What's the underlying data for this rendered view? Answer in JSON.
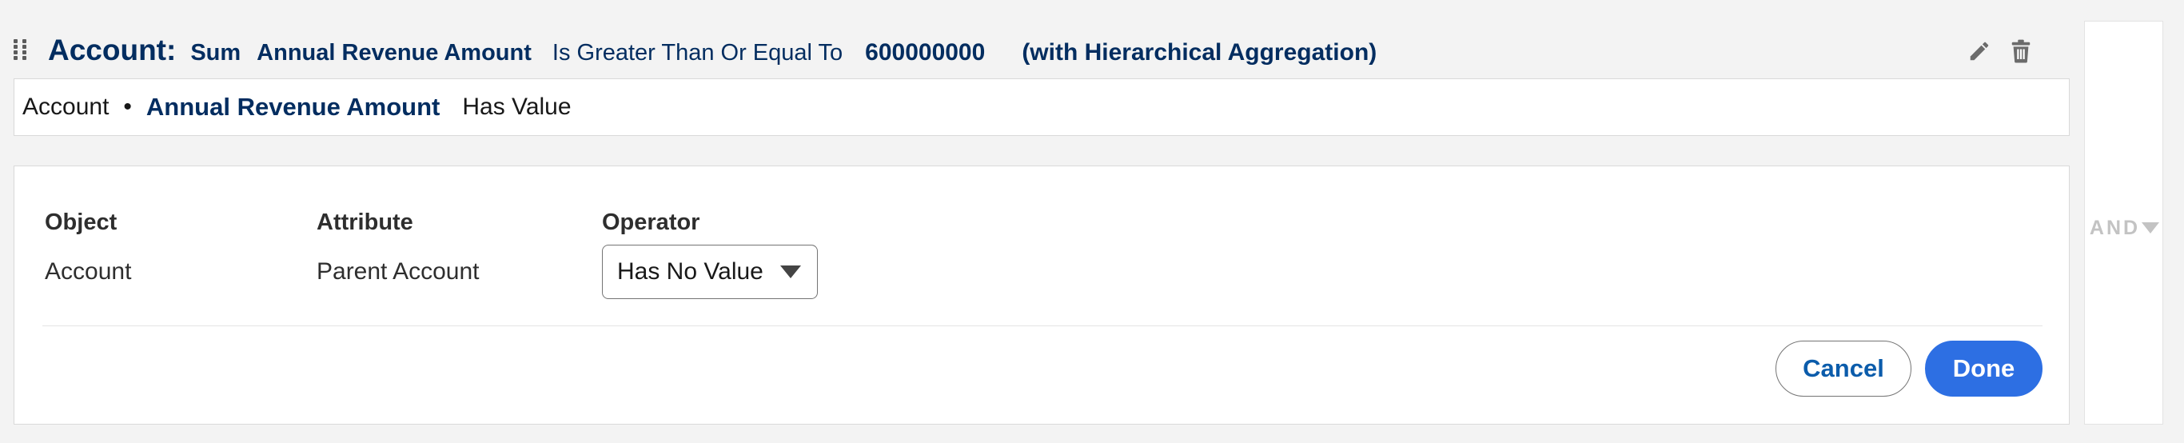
{
  "header": {
    "object_label": "Account:",
    "aggregation": "Sum",
    "field": "Annual Revenue Amount",
    "operator": "Is Greater Than Or Equal To",
    "value": "600000000",
    "note": "(with Hierarchical Aggregation)",
    "icons": [
      "drag-handle-icon",
      "pencil-icon",
      "trash-icon"
    ]
  },
  "summary": {
    "object": "Account",
    "separator": "•",
    "field": "Annual Revenue Amount",
    "operator": "Has Value"
  },
  "editor": {
    "columns": {
      "object_label": "Object",
      "attribute_label": "Attribute",
      "operator_label": "Operator"
    },
    "object_value": "Account",
    "attribute_value": "Parent Account",
    "operator_selected": "Has No Value",
    "cancel_label": "Cancel",
    "done_label": "Done"
  },
  "logic": {
    "label": "AND"
  },
  "colors": {
    "header_text": "#032d60",
    "primary_button": "#2d6fe3",
    "link_button_text": "#0b5cab",
    "muted": "#c3c3c3"
  }
}
